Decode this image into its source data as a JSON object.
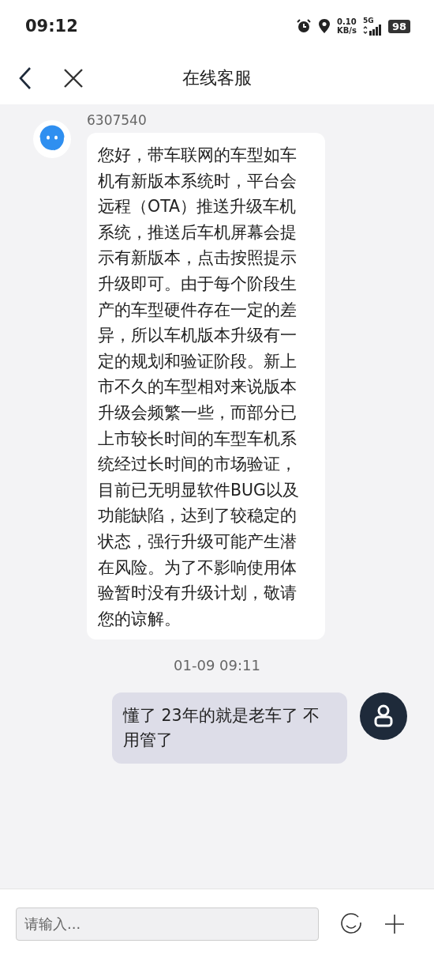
{
  "status_bar": {
    "time": "09:12",
    "speed_value": "0.10",
    "speed_unit": "KB/s",
    "network": "5G",
    "battery": "98"
  },
  "header": {
    "title": "在线客服"
  },
  "messages": [
    {
      "kind": "incoming",
      "sender": "6307540",
      "text": "您好，带车联网的车型如车机有新版本系统时，平台会远程（OTA）推送升级车机系统，推送后车机屏幕会提示有新版本，点击按照提示升级即可。由于每个阶段生产的车型硬件存在一定的差异，所以车机版本升级有一定的规划和验证阶段。新上市不久的车型相对来说版本升级会频繁一些，而部分已上市较长时间的车型车机系统经过长时间的市场验证，目前已无明显软件BUG以及功能缺陷，达到了较稳定的状态，强行升级可能产生潜在风险。为了不影响使用体验暂时没有升级计划，敬请您的谅解。"
    },
    {
      "kind": "time",
      "text": "01-09 09:11"
    },
    {
      "kind": "outgoing",
      "text": "懂了 23年的就是老车了 不用管了"
    }
  ],
  "composer": {
    "placeholder": "请输入..."
  }
}
